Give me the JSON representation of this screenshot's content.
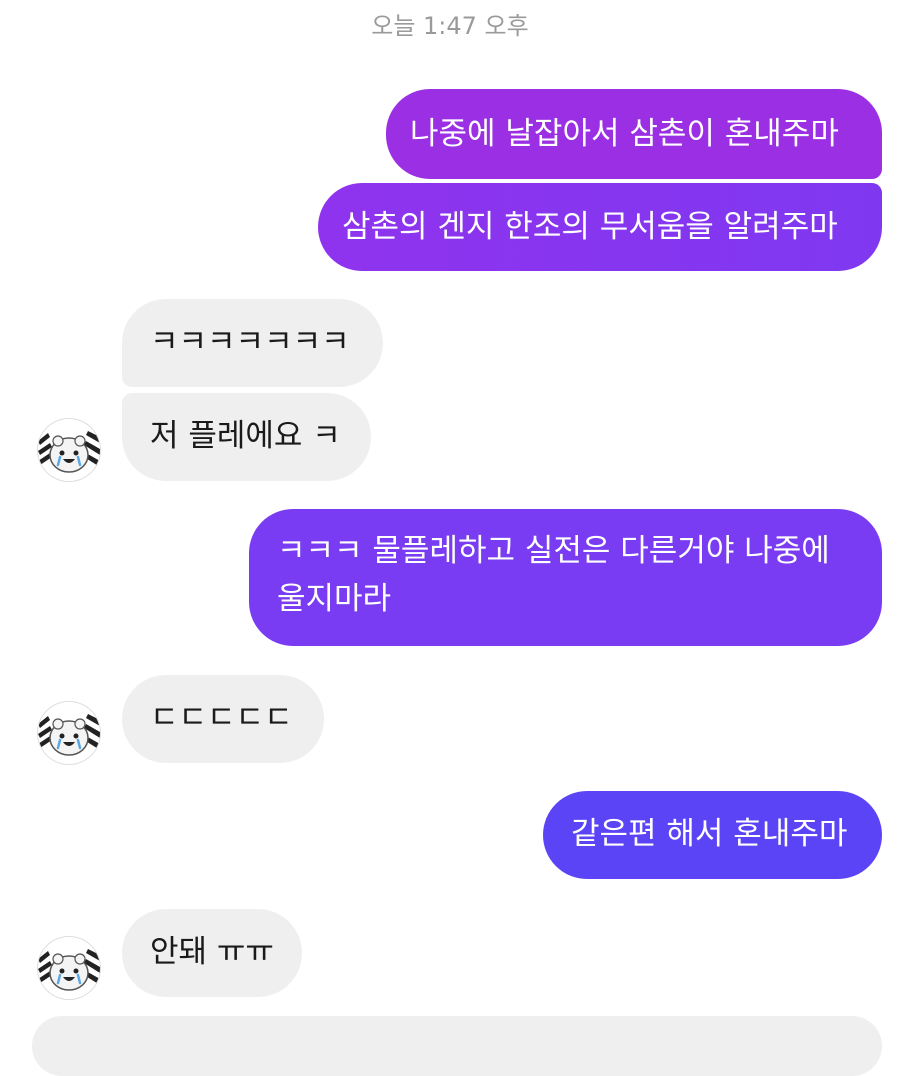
{
  "thread": {
    "timestamp": "오늘 1:47 오후"
  },
  "messages": [
    {
      "side": "sent",
      "text": "나중에 날잡아서 삼촌이 혼내주마"
    },
    {
      "side": "sent",
      "text": "삼촌의 겐지 한조의 무서움을 알려주마"
    },
    {
      "side": "received",
      "text": "ㅋㅋㅋㅋㅋㅋㅋ"
    },
    {
      "side": "received",
      "text": "저 플레에요 ㅋ"
    },
    {
      "side": "sent",
      "line1": "ㅋㅋㅋ 물플레하고 실전은 다른거야 나중에",
      "line2": "울지마라"
    },
    {
      "side": "received",
      "text": "ㄷㄷㄷㄷㄷ"
    },
    {
      "side": "sent",
      "text": "같은편 해서 혼내주마"
    },
    {
      "side": "received",
      "text": "안돼 ㅠㅠ"
    }
  ],
  "colors": {
    "sent_top": "#9b2fe4",
    "sent_mid": "#7a3cf2",
    "sent_bottom": "#5b43f6",
    "received": "#efefef",
    "timestamp": "#9a9a9a"
  },
  "icons": {
    "avatar": "cartoon-avatar-icon"
  }
}
